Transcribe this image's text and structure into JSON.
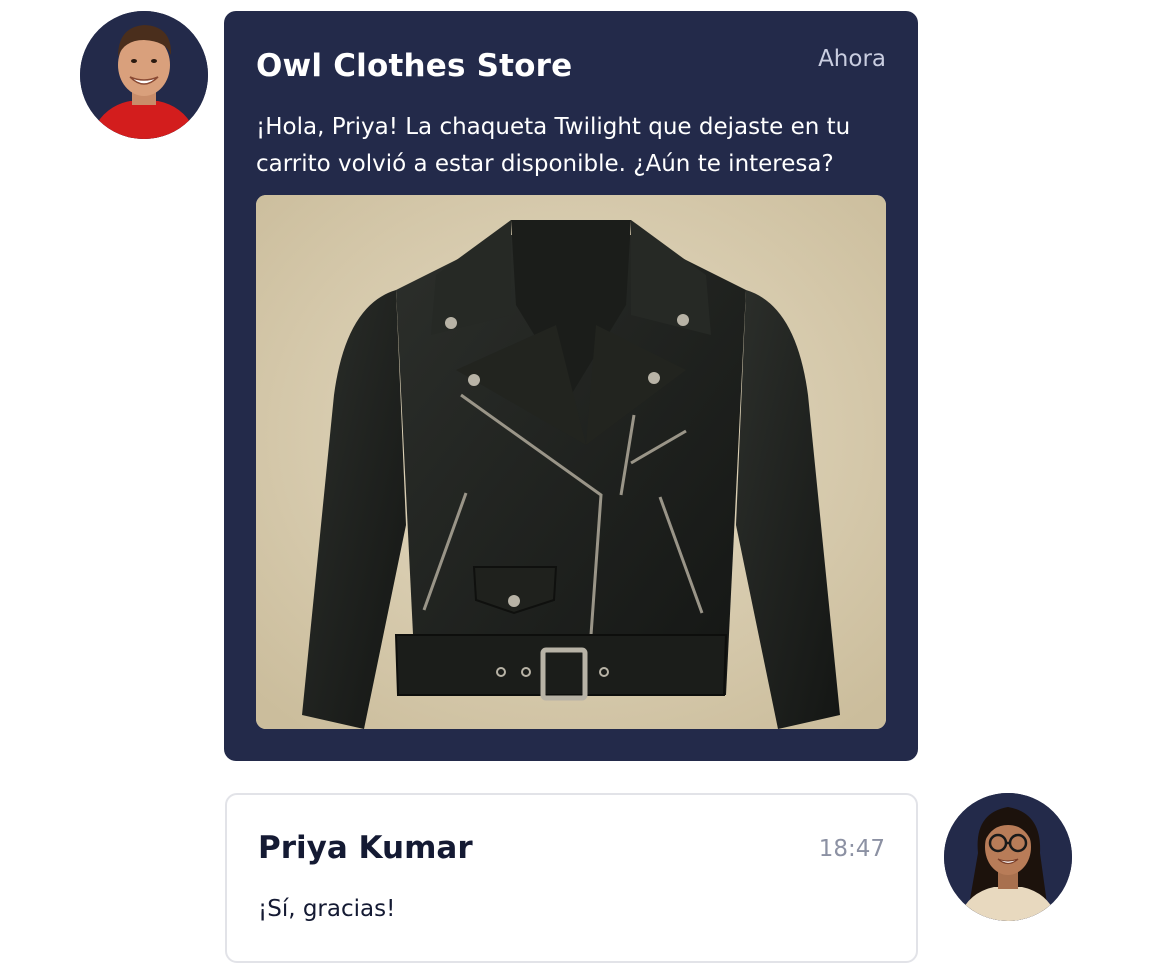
{
  "messages": [
    {
      "sender": "Owl Clothes Store",
      "time": "Ahora",
      "text": "¡Hola, Priya! La chaqueta Twilight que dejaste en tu carrito volvió a estar disponible. ¿Aún te interesa?",
      "attachment": "leather-jacket-image"
    },
    {
      "sender": "Priya Kumar",
      "time": "18:47",
      "text": "¡Sí, gracias!"
    }
  ],
  "colors": {
    "incoming_bubble": "#232a4a",
    "outgoing_bubble_border": "#e2e3e8",
    "avatar_bg": "#232a4a"
  },
  "icons": [
    "store-avatar",
    "user-avatar"
  ]
}
